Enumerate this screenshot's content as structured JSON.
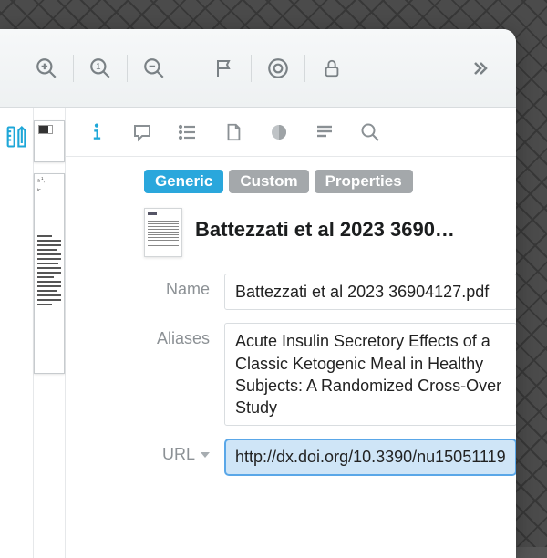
{
  "tabs": {
    "generic": "Generic",
    "custom": "Custom",
    "properties": "Properties"
  },
  "item": {
    "title": "Battezzati et al 2023 3690…"
  },
  "fields": {
    "name": {
      "label": "Name",
      "value": "Battezzati et al 2023 36904127.pdf"
    },
    "aliases": {
      "label": "Aliases",
      "value": "Acute Insulin Secretory Effects of a Classic Ketogenic Meal in Healthy Subjects: A Randomized Cross-Over Study"
    },
    "url": {
      "label": "URL",
      "value": "http://dx.doi.org/10.3390/nu15051119"
    }
  }
}
